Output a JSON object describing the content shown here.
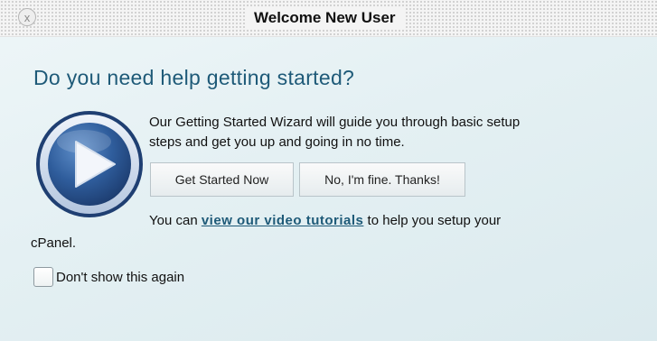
{
  "dialog": {
    "title": "Welcome New User",
    "close_symbol": "x",
    "close_icon": "close-icon"
  },
  "content": {
    "heading": "Do you need help getting started?",
    "description_line1": "Our Getting Started Wizard will guide you through basic setup",
    "description_line2": "steps and get you up and going in no time.",
    "play_icon": "play-icon",
    "buttons": {
      "get_started": "Get Started Now",
      "no_thanks": "No, I'm fine. Thanks!"
    },
    "tutorial_prefix": "You can ",
    "tutorial_link": "view our video tutorials",
    "tutorial_suffix": " to help you setup your",
    "tutorial_line2": "cPanel."
  },
  "footer": {
    "checkbox_label": "Don't show this again",
    "checkbox_checked": false
  },
  "colors": {
    "heading": "#1e5a78",
    "play_circle": "#2d5a9a",
    "play_ring": "#c9d7ea"
  }
}
